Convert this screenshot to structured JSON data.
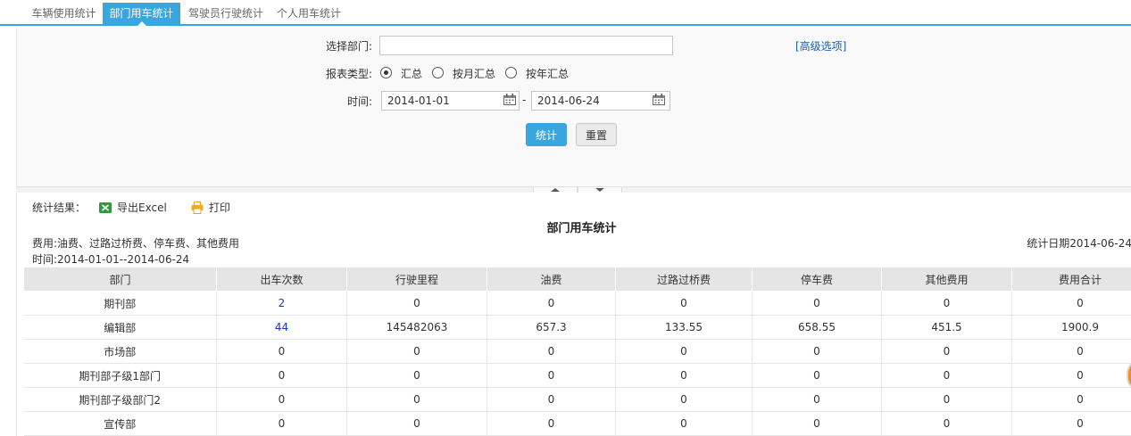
{
  "tabs": [
    {
      "label": "车辆使用统计",
      "active": false
    },
    {
      "label": "部门用车统计",
      "active": true
    },
    {
      "label": "驾驶员行驶统计",
      "active": false
    },
    {
      "label": "个人用车统计",
      "active": false
    }
  ],
  "search": {
    "dept_label": "选择部门:",
    "dept_value": "",
    "advanced_link": "[高级选项]",
    "report_type_label": "报表类型:",
    "report_types": [
      {
        "label": "汇总",
        "checked": true
      },
      {
        "label": "按月汇总",
        "checked": false
      },
      {
        "label": "按年汇总",
        "checked": false
      }
    ],
    "time_label": "时间:",
    "date_from": "2014-01-01",
    "date_sep": "-",
    "date_to": "2014-06-24",
    "submit_label": "统计",
    "reset_label": "重置"
  },
  "result": {
    "label": "统计结果：",
    "export_label": "导出Excel",
    "print_label": "打印",
    "report_title": "部门用车统计",
    "costs_note": "费用:油费、过路过桥费、停车费、其他费用",
    "stat_date": "统计日期2014-06-24",
    "time_range": "时间:2014-01-01--2014-06-24",
    "columns": [
      "部门",
      "出车次数",
      "行驶里程",
      "油费",
      "过路过桥费",
      "停车费",
      "其他费用",
      "费用合计"
    ],
    "rows": [
      [
        "期刊部",
        "2",
        "0",
        "0",
        "0",
        "0",
        "0",
        "0"
      ],
      [
        "编辑部",
        "44",
        "145482063",
        "657.3",
        "133.55",
        "658.55",
        "451.5",
        "1900.9"
      ],
      [
        "市场部",
        "0",
        "0",
        "0",
        "0",
        "0",
        "0",
        "0"
      ],
      [
        "期刊部子级1部门",
        "0",
        "0",
        "0",
        "0",
        "0",
        "0",
        "0"
      ],
      [
        "期刊部子级部门2",
        "0",
        "0",
        "0",
        "0",
        "0",
        "0",
        "0"
      ],
      [
        "宣传部",
        "0",
        "0",
        "0",
        "0",
        "0",
        "0",
        "0"
      ]
    ]
  },
  "colors": {
    "accent": "#3aa6e0",
    "link": "#1a35c0",
    "header_bg": "#e5e5e5",
    "panel_bg": "#f9f9f9"
  },
  "icons": {
    "excel": "excel-icon",
    "print": "printer-icon",
    "calendar": "calendar-icon"
  }
}
